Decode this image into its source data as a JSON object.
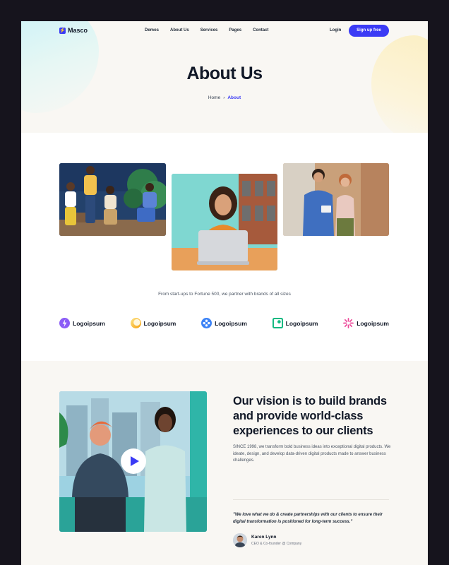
{
  "nav": {
    "logo": "Masco",
    "logo_mark": "⚡",
    "items": [
      "Demos",
      "About Us",
      "Services",
      "Pages",
      "Contact"
    ],
    "login": "Login",
    "signup": "Sign up free"
  },
  "hero": {
    "title": "About Us",
    "breadcrumb": {
      "home": "Home",
      "separator": "›",
      "current": "About"
    }
  },
  "partners": {
    "text": "From start-ups to Fortune 500, we partner with brands of all sizes",
    "brands": [
      {
        "name": "Logoipsum",
        "icon": "bolt-badge-icon",
        "color": "#8b5cf6"
      },
      {
        "name": "Logoipsum",
        "icon": "circle-gradient-icon",
        "color": "#fcd34d"
      },
      {
        "name": "Logoipsum",
        "icon": "diamond-dots-icon",
        "color": "#3b82f6"
      },
      {
        "name": "Logoipsum",
        "icon": "square-loop-icon",
        "color": "#10b981"
      },
      {
        "name": "Logoipsum",
        "icon": "sunburst-icon",
        "color": "#ec4899"
      }
    ]
  },
  "vision": {
    "title": "Our vision is to build brands and provide world-class experiences to our clients",
    "body": "SINCE 1998, we transform bold business ideas into exceptional digital products. We ideate, design, and develop data-driven digital products made to answer business challenges.",
    "quote": "\"We love what we do & create partnerships with our clients to ensure their digital transformation is positioned for long-term success.\"",
    "author": {
      "name": "Karen Lynn",
      "role": "CEO & Co-founder @ Company"
    }
  },
  "colors": {
    "accent": "#3b3bf5",
    "hero_bg": "#f9f7f3",
    "dark_frame": "#16141d"
  }
}
